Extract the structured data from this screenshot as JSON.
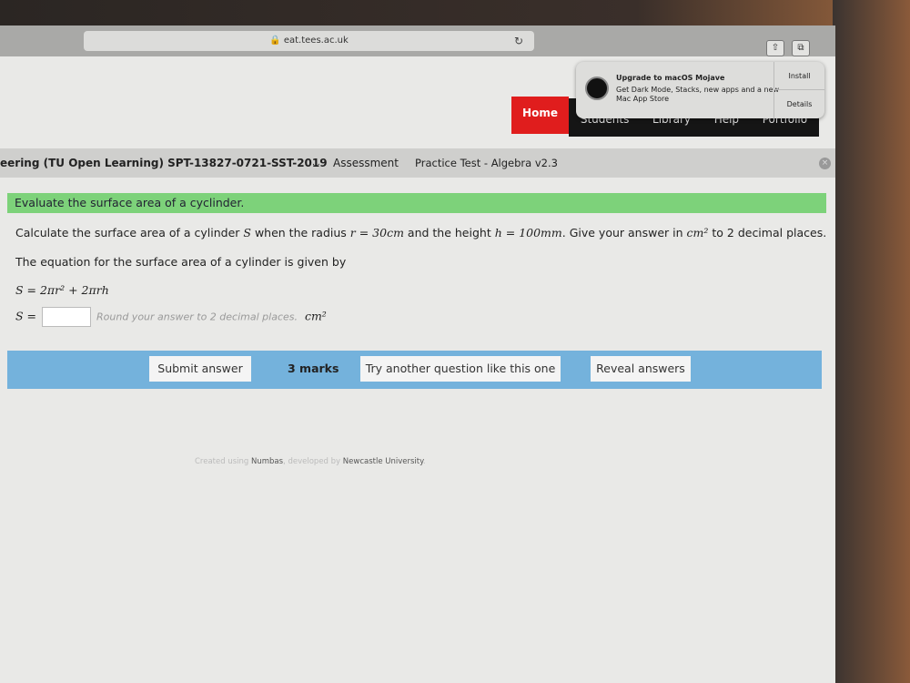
{
  "browser": {
    "url": "eat.tees.ac.uk",
    "reload_icon": "reload-icon",
    "share_icon": "share-icon",
    "tabs_icon": "tabs-icon"
  },
  "notification": {
    "title": "Upgrade to macOS Mojave",
    "body": "Get Dark Mode, Stacks, new apps and a new Mac App Store",
    "install": "Install",
    "details": "Details"
  },
  "nav": {
    "items": [
      "Home",
      "Students",
      "Library",
      "Help",
      "Portfolio"
    ]
  },
  "breadcrumb": {
    "course": "eering (TU Open Learning) SPT-13827-0721-SST-2019",
    "ellipsis": "...",
    "assessment": "Assessment",
    "test": "Practice Test - Algebra v2.3"
  },
  "question": {
    "heading": "Evaluate the surface area of a cyclinder.",
    "p1_a": "Calculate the surface area of a cylinder ",
    "p1_S": "S",
    "p1_b": " when the radius ",
    "p1_r": "r = 30cm",
    "p1_c": " and the height ",
    "p1_h": "h = 100mm",
    "p1_d": ". Give your answer in ",
    "p1_unit": "cm²",
    "p1_e": " to 2 decimal places.",
    "p2": "The equation for the surface area of a cylinder is given by",
    "equation": "S = 2πr² + 2πrh",
    "answer_label": "S =",
    "answer_value": "",
    "hint": "Round your answer to 2 decimal places.",
    "unit": "cm²"
  },
  "actions": {
    "submit": "Submit answer",
    "marks": "3 marks",
    "try_another": "Try another question like this one",
    "reveal": "Reveal answers"
  },
  "footer": {
    "a": "Created using ",
    "numbas": "Numbas",
    "b": ", developed by ",
    "ncl": "Newcastle University",
    "c": "."
  }
}
